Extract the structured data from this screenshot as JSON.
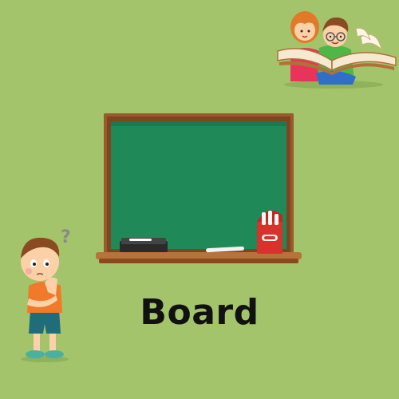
{
  "colors": {
    "background": "#a3c46a",
    "board_surface": "#1f8a57",
    "board_frame": "#9c5a2a",
    "chalk_box": "#d8322c",
    "text": "#111111"
  },
  "illustrations": {
    "reading_kids": "reading-kids-icon",
    "thinking_boy": "thinking-boy-icon",
    "chalkboard": "chalkboard-icon"
  },
  "label": {
    "word": "Board"
  }
}
